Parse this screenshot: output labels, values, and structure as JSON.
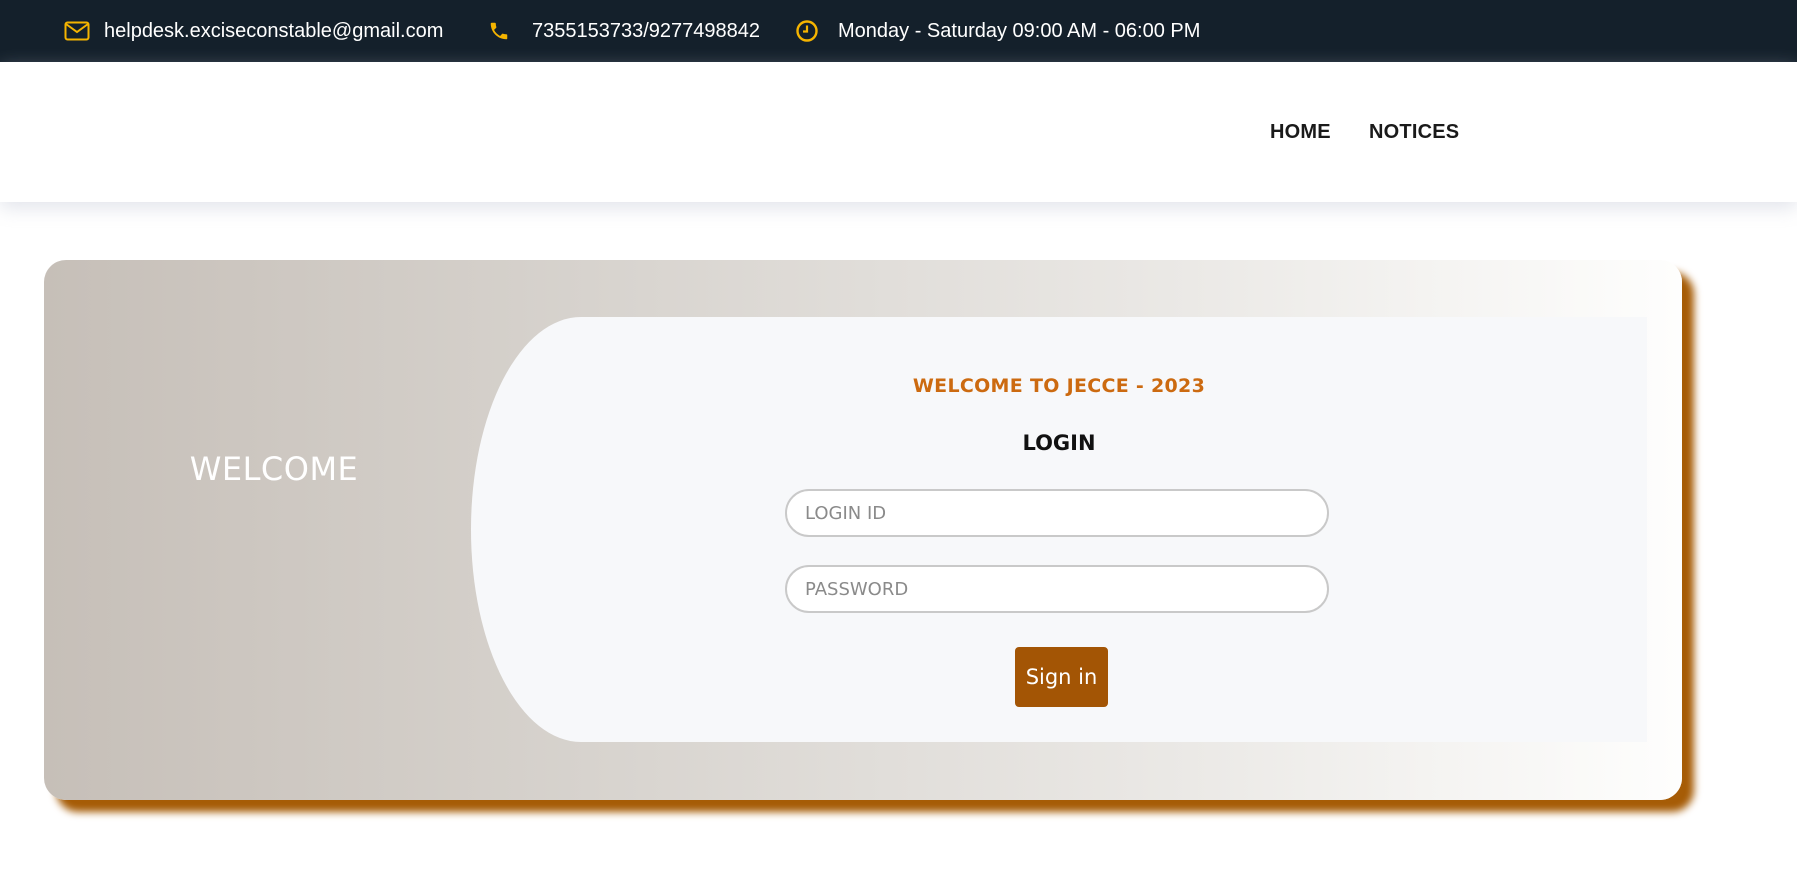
{
  "topbar": {
    "email": "helpdesk.exciseconstable@gmail.com",
    "phone": "7355153733/9277498842",
    "hours": "Monday - Saturday 09:00 AM - 06:00 PM",
    "icons": {
      "email": "envelope-icon",
      "phone": "phone-icon",
      "hours": "clock-icon"
    },
    "icon_color": "#f5b400",
    "background": "#14202b"
  },
  "nav": {
    "items": [
      {
        "label": "HOME"
      },
      {
        "label": "NOTICES"
      }
    ]
  },
  "card": {
    "welcome": "WELCOME",
    "title": "WELCOME TO JECCE - 2023",
    "login_heading": "LOGIN",
    "login_id_placeholder": "LOGIN ID",
    "password_placeholder": "PASSWORD",
    "signin_label": "Sign in",
    "accent": "#a35505",
    "title_color": "#cc6a10"
  }
}
